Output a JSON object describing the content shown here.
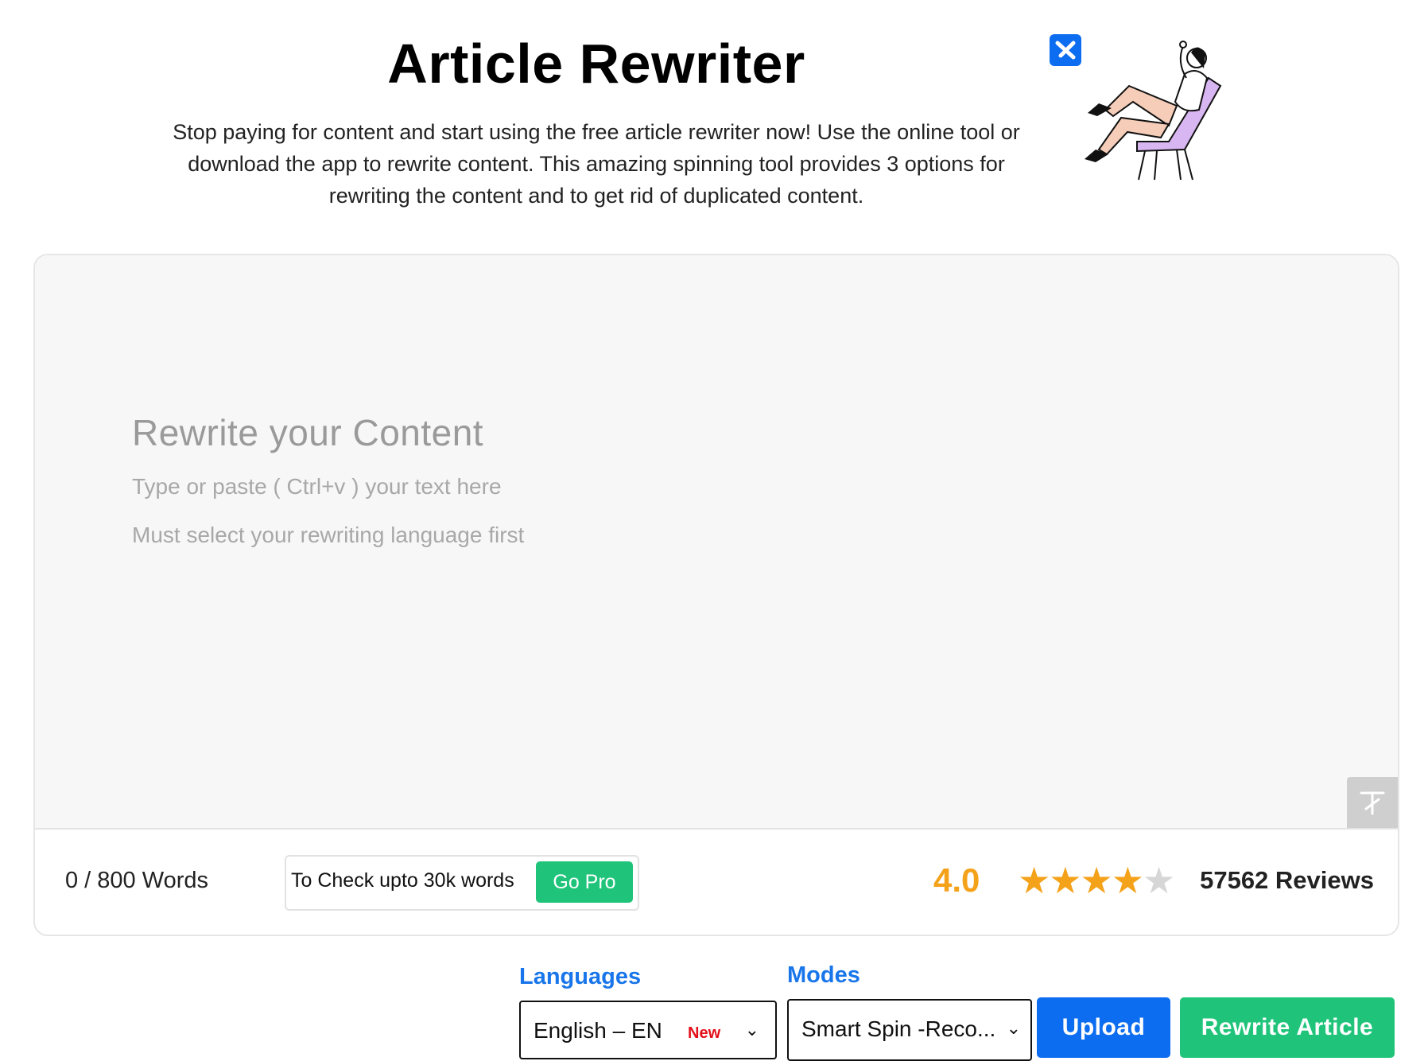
{
  "header": {
    "title": "Article Rewriter",
    "description": "Stop paying for content and start using the free article rewriter now! Use the online tool or download the app to rewrite content. This amazing spinning tool provides 3 options for rewriting the content and to get rid of duplicated content."
  },
  "editor": {
    "placeholder_title": "Rewrite your Content",
    "placeholder_line1": "Type or paste ( Ctrl+v ) your text here",
    "placeholder_line2": "Must select your rewriting language first"
  },
  "footer_bar": {
    "word_count": "0 / 800 Words",
    "pro_text": "To Check upto 30k words",
    "go_pro_label": "Go Pro",
    "rating": "4.0",
    "rating_value": 4,
    "rating_max": 5,
    "reviews": "57562 Reviews"
  },
  "controls": {
    "languages_label": "Languages",
    "language_value": "English – EN",
    "language_badge": "New",
    "modes_label": "Modes",
    "mode_value": "Smart Spin -Reco...",
    "upload_label": "Upload",
    "rewrite_label": "Rewrite Article"
  },
  "colors": {
    "accent_blue": "#0d6df0",
    "accent_green": "#1fc47a",
    "rating_orange": "#f5a21b",
    "badge_red": "#e3101a"
  },
  "icons": {
    "hero": "person-in-chair-illustration",
    "brand": "brand-logo-icon",
    "translate": "translate-icon",
    "chevron": "chevron-down-icon",
    "star": "star-icon"
  }
}
